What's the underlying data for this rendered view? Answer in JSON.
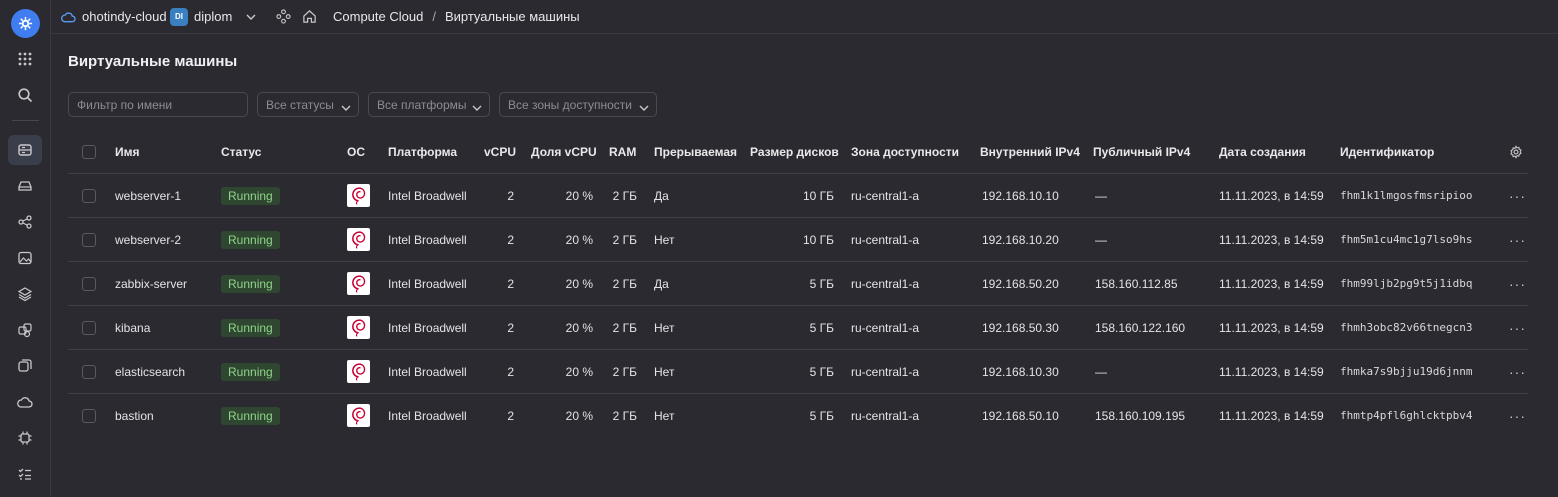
{
  "topbar": {
    "cloud": "ohotindy-cloud",
    "folder_badge": "DI",
    "folder": "diplom",
    "service": "Compute Cloud",
    "separator": "/",
    "current": "Виртуальные машины"
  },
  "page": {
    "title": "Виртуальные машины"
  },
  "filters": {
    "name_placeholder": "Фильтр по имени",
    "status": "Все статусы",
    "platform": "Все платформы",
    "zone": "Все зоны доступности"
  },
  "columns": {
    "name": "Имя",
    "status": "Статус",
    "os": "ОС",
    "platform": "Платформа",
    "vcpu": "vCPU",
    "vcpu_share": "Доля vCPU",
    "ram": "RAM",
    "preemptible": "Прерываемая",
    "disk": "Размер дисков",
    "zone": "Зона доступности",
    "ipv4_int": "Внутренний IPv4",
    "ipv4_pub": "Публичный IPv4",
    "created": "Дата создания",
    "id": "Идентификатор"
  },
  "rows": [
    {
      "name": "webserver-1",
      "status": "Running",
      "platform": "Intel Broadwell",
      "vcpu": "2",
      "share": "20 %",
      "ram": "2 ГБ",
      "preemptible": "Да",
      "disk": "10 ГБ",
      "zone": "ru-central1-a",
      "ip_int": "192.168.10.10",
      "ip_pub": "—",
      "created": "11.11.2023, в 14:59",
      "id": "fhm1k1lmgosfmsripioo"
    },
    {
      "name": "webserver-2",
      "status": "Running",
      "platform": "Intel Broadwell",
      "vcpu": "2",
      "share": "20 %",
      "ram": "2 ГБ",
      "preemptible": "Нет",
      "disk": "10 ГБ",
      "zone": "ru-central1-a",
      "ip_int": "192.168.10.20",
      "ip_pub": "—",
      "created": "11.11.2023, в 14:59",
      "id": "fhm5m1cu4mc1g7lso9hs"
    },
    {
      "name": "zabbix-server",
      "status": "Running",
      "platform": "Intel Broadwell",
      "vcpu": "2",
      "share": "20 %",
      "ram": "2 ГБ",
      "preemptible": "Да",
      "disk": "5 ГБ",
      "zone": "ru-central1-a",
      "ip_int": "192.168.50.20",
      "ip_pub": "158.160.112.85",
      "created": "11.11.2023, в 14:59",
      "id": "fhm99ljb2pg9t5j1idbq"
    },
    {
      "name": "kibana",
      "status": "Running",
      "platform": "Intel Broadwell",
      "vcpu": "2",
      "share": "20 %",
      "ram": "2 ГБ",
      "preemptible": "Нет",
      "disk": "5 ГБ",
      "zone": "ru-central1-a",
      "ip_int": "192.168.50.30",
      "ip_pub": "158.160.122.160",
      "created": "11.11.2023, в 14:59",
      "id": "fhmh3obc82v66tnegcn3"
    },
    {
      "name": "elasticsearch",
      "status": "Running",
      "platform": "Intel Broadwell",
      "vcpu": "2",
      "share": "20 %",
      "ram": "2 ГБ",
      "preemptible": "Нет",
      "disk": "5 ГБ",
      "zone": "ru-central1-a",
      "ip_int": "192.168.10.30",
      "ip_pub": "—",
      "created": "11.11.2023, в 14:59",
      "id": "fhmka7s9bjju19d6jnnm"
    },
    {
      "name": "bastion",
      "status": "Running",
      "platform": "Intel Broadwell",
      "vcpu": "2",
      "share": "20 %",
      "ram": "2 ГБ",
      "preemptible": "Нет",
      "disk": "5 ГБ",
      "zone": "ru-central1-a",
      "ip_int": "192.168.50.10",
      "ip_pub": "158.160.109.195",
      "created": "11.11.2023, в 14:59",
      "id": "fhmtp4pfl6ghlcktpbv4"
    }
  ],
  "row_menu": "···",
  "icons": {
    "rail": [
      "grid-icon",
      "search-icon",
      "compute-icon",
      "disk-icon",
      "network-icon",
      "image-icon",
      "layers-icon",
      "instance-groups-icon",
      "snapshot-icon",
      "cloud-icon",
      "chip-icon",
      "checklist-icon"
    ],
    "table": "settings-gear-icon",
    "os": "debian-logo-icon"
  },
  "colors": {
    "accent": "#3f7df0",
    "status_running_bg": "#2f4630",
    "status_running_fg": "#8fd48a",
    "background": "#2b2a30"
  }
}
